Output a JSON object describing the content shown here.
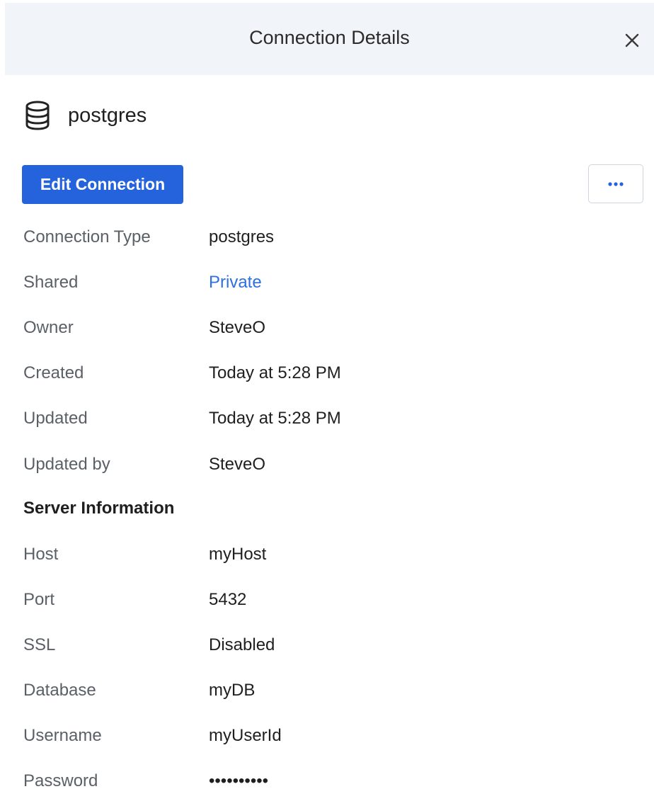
{
  "header": {
    "title": "Connection Details",
    "close_icon": "close-icon"
  },
  "connection": {
    "icon": "database-icon",
    "name": "postgres"
  },
  "actions": {
    "edit_label": "Edit Connection",
    "more_icon": "ellipsis-icon",
    "accent_color": "#2563dc"
  },
  "details": {
    "connection_type": {
      "label": "Connection Type",
      "value": "postgres"
    },
    "shared": {
      "label": "Shared",
      "value": "Private",
      "link_color": "#2f6fdf"
    },
    "owner": {
      "label": "Owner",
      "value": "SteveO"
    },
    "created": {
      "label": "Created",
      "value": "Today at 5:28 PM"
    },
    "updated": {
      "label": "Updated",
      "value": "Today at 5:28 PM"
    },
    "updated_by": {
      "label": "Updated by",
      "value": "SteveO"
    }
  },
  "server": {
    "heading": "Server Information",
    "host": {
      "label": "Host",
      "value": "myHost"
    },
    "port": {
      "label": "Port",
      "value": "5432"
    },
    "ssl": {
      "label": "SSL",
      "value": "Disabled"
    },
    "database": {
      "label": "Database",
      "value": "myDB"
    },
    "username": {
      "label": "Username",
      "value": "myUserId"
    },
    "password": {
      "label": "Password",
      "value": "••••••••••"
    }
  }
}
